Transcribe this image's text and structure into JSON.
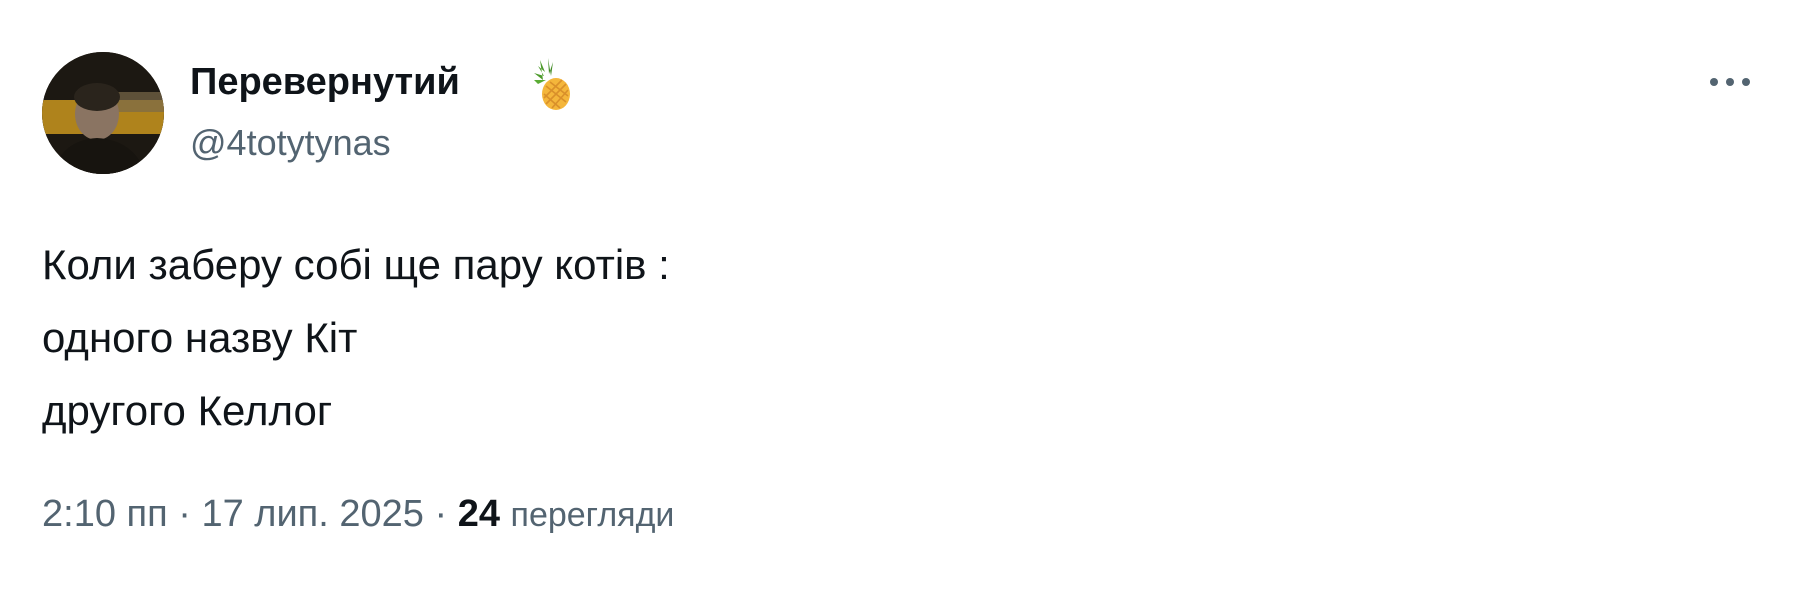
{
  "author": {
    "display_name": "Перевернутий",
    "handle": "@4totytynas",
    "badge_icon": "pineapple-icon",
    "avatar_icon": "avatar"
  },
  "more_icon": "more-dots-icon",
  "tweet": {
    "lines": [
      "Коли заберу собі ще пару котів :",
      "одного назву Кіт",
      "другого Келлог"
    ]
  },
  "meta": {
    "time": "2:10 пп",
    "separator": "·",
    "date": "17 лип. 2025",
    "views_count": "24",
    "views_label": "перегляди"
  },
  "colors": {
    "text_primary": "#0f1419",
    "text_secondary": "#536471"
  }
}
